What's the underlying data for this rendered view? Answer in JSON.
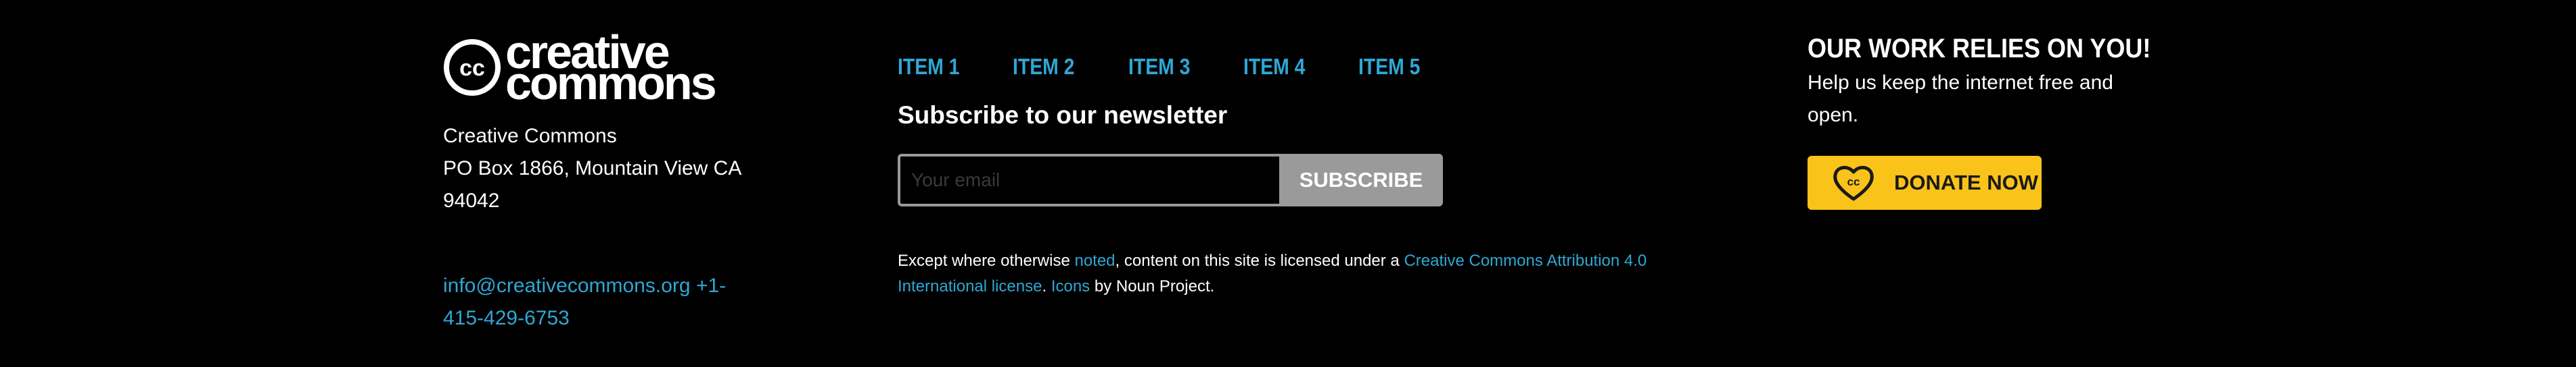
{
  "brand": {
    "logo_line1": "creative",
    "logo_line2": "commons",
    "logo_mark": "cc"
  },
  "address": {
    "lines": [
      "Creative Commons",
      "PO Box 1866, Mountain View CA",
      "94042"
    ]
  },
  "contact": {
    "email": "info@creativecommons.org",
    "phone": "+1-415-429-6753"
  },
  "nav": {
    "items": [
      {
        "label": "ITEM 1"
      },
      {
        "label": "ITEM 2"
      },
      {
        "label": "ITEM 3"
      },
      {
        "label": "ITEM 4"
      },
      {
        "label": "ITEM 5"
      }
    ]
  },
  "newsletter": {
    "title": "Subscribe to our newsletter",
    "email_placeholder": "Your email",
    "email_value": "",
    "submit_label": "SUBSCRIBE"
  },
  "license": {
    "text_1": "Except where otherwise ",
    "link_noted": "noted",
    "text_2": ", content on this site is licensed under a ",
    "link_license": "Creative Commons Attribution 4.0 International license",
    "text_3": ". ",
    "link_icons": "Icons",
    "text_4": " by Noun Project."
  },
  "support": {
    "title": "OUR WORK RELIES ON YOU!",
    "text": "Help us keep the internet free and open.",
    "donate_label": "DONATE NOW",
    "donate_icon": "heart-cc-icon"
  },
  "colors": {
    "background": "#000000",
    "link": "#2fa7d4",
    "donate": "#f9c31a",
    "button_gray": "#9a9a9a"
  }
}
